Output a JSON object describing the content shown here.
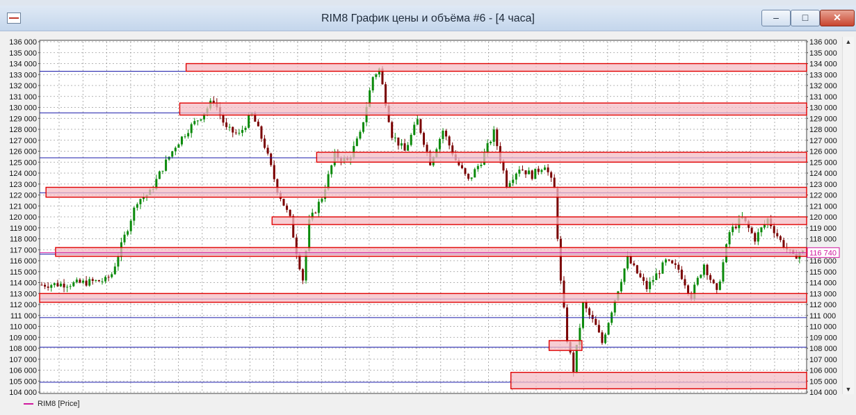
{
  "window": {
    "title": "RIM8 График цены и объёма #6 - [4 часа]",
    "buttons": {
      "minimize": "–",
      "maximize": "□",
      "close": "✕"
    }
  },
  "legend": {
    "label": "RIM8 [Price]",
    "color": "#d0189e"
  },
  "price_tag": {
    "value": "116 740",
    "price": 116740,
    "color": "#d0189e"
  },
  "colors": {
    "up": "#0b8a0b",
    "down": "#7a0000",
    "zone_fill": "#f4bcc4",
    "zone_border": "#e00000",
    "level_line": "#1a1aaa"
  },
  "chart_data": {
    "type": "candlestick",
    "symbol": "RIM8",
    "timeframe": "4 часа",
    "ylim": [
      104000,
      136000
    ],
    "ytick_step": 1000,
    "ytick_labels": [
      "136 000",
      "135 000",
      "134 000",
      "133 000",
      "132 000",
      "131 000",
      "130 000",
      "129 000",
      "128 000",
      "127 000",
      "126 000",
      "125 000",
      "124 000",
      "123 000",
      "122 000",
      "121 000",
      "120 000",
      "119 000",
      "118 000",
      "117 000",
      "116 000",
      "115 000",
      "114 000",
      "113 000",
      "112 000",
      "111 000",
      "110 000",
      "109 000",
      "108 000",
      "107 000",
      "106 000",
      "105 000",
      "104 000"
    ],
    "grid": true,
    "horizontal_levels": [
      133300,
      129500,
      125400,
      122200,
      116600,
      112500,
      110800,
      108100,
      104900
    ],
    "zones": [
      {
        "from": 133300,
        "to": 134000,
        "start_index": 46
      },
      {
        "from": 129300,
        "to": 130400,
        "start_index": 44
      },
      {
        "from": 125000,
        "to": 125900,
        "start_index": 87
      },
      {
        "from": 121800,
        "to": 122700,
        "start_index": 2
      },
      {
        "from": 119300,
        "to": 120000,
        "start_index": 73
      },
      {
        "from": 116400,
        "to": 117200,
        "start_index": 5
      },
      {
        "from": 112200,
        "to": 113000,
        "start_index": 0
      },
      {
        "from": 107800,
        "to": 108700,
        "start_index": 160,
        "end_index": 169
      },
      {
        "from": 104300,
        "to": 105800,
        "start_index": 148
      }
    ],
    "close_path": [
      [
        0,
        113800
      ],
      [
        10,
        113900
      ],
      [
        20,
        114200
      ],
      [
        22,
        114800
      ],
      [
        26,
        118200
      ],
      [
        30,
        121500
      ],
      [
        34,
        122200
      ],
      [
        38,
        124500
      ],
      [
        42,
        126500
      ],
      [
        46,
        128000
      ],
      [
        50,
        129200
      ],
      [
        54,
        130700
      ],
      [
        58,
        128000
      ],
      [
        62,
        127500
      ],
      [
        66,
        129400
      ],
      [
        70,
        126500
      ],
      [
        74,
        122500
      ],
      [
        78,
        119800
      ],
      [
        80,
        116800
      ],
      [
        82,
        114300
      ],
      [
        84,
        119500
      ],
      [
        88,
        121800
      ],
      [
        92,
        125600
      ],
      [
        96,
        125100
      ],
      [
        100,
        127500
      ],
      [
        104,
        132800
      ],
      [
        106,
        133500
      ],
      [
        110,
        127500
      ],
      [
        114,
        126000
      ],
      [
        118,
        128800
      ],
      [
        122,
        125000
      ],
      [
        126,
        127900
      ],
      [
        130,
        125200
      ],
      [
        134,
        123300
      ],
      [
        138,
        125100
      ],
      [
        142,
        127700
      ],
      [
        146,
        123000
      ],
      [
        150,
        124500
      ],
      [
        154,
        123800
      ],
      [
        158,
        124800
      ],
      [
        161,
        122500
      ],
      [
        163,
        114000
      ],
      [
        165,
        108800
      ],
      [
        167,
        106000
      ],
      [
        170,
        112000
      ],
      [
        174,
        110000
      ],
      [
        176,
        108500
      ],
      [
        180,
        112500
      ],
      [
        184,
        116200
      ],
      [
        190,
        113500
      ],
      [
        196,
        115900
      ],
      [
        200,
        115200
      ],
      [
        204,
        112800
      ],
      [
        208,
        115700
      ],
      [
        212,
        113000
      ],
      [
        216,
        118600
      ],
      [
        220,
        119900
      ],
      [
        224,
        118000
      ],
      [
        228,
        119800
      ],
      [
        232,
        117800
      ],
      [
        236,
        116300
      ],
      [
        238,
        116740
      ]
    ]
  }
}
